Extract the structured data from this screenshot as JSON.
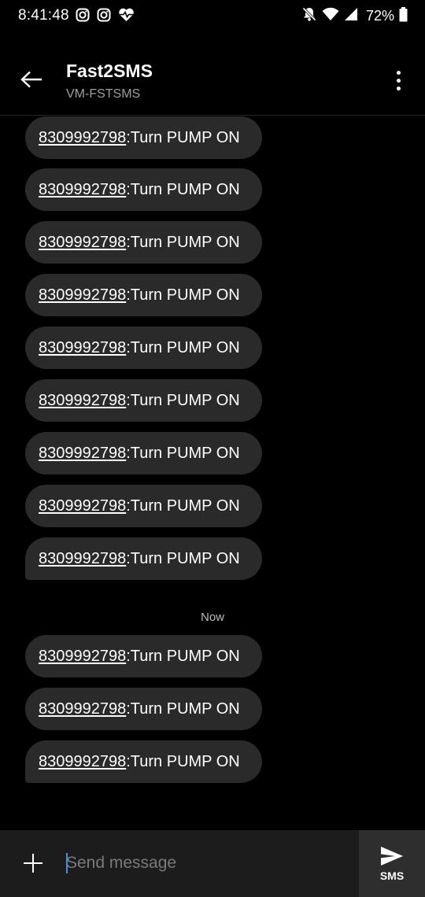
{
  "status_bar": {
    "time": "8:41:48",
    "battery_percent": "72%",
    "left_icons": [
      "instagram-icon",
      "instagram-icon",
      "heart-pulse-icon"
    ],
    "right_icons": [
      "mute-bell-icon",
      "wifi-icon",
      "signal-icon",
      "battery-icon"
    ]
  },
  "header": {
    "title": "Fast2SMS",
    "subtitle": "VM-FSTSMS"
  },
  "messages_group1": [
    {
      "number": "8309992798",
      "text": ":Turn PUMP ON"
    },
    {
      "number": "8309992798",
      "text": ":Turn PUMP ON"
    },
    {
      "number": "8309992798",
      "text": ":Turn PUMP ON"
    },
    {
      "number": "8309992798",
      "text": ":Turn PUMP ON"
    },
    {
      "number": "8309992798",
      "text": ":Turn PUMP ON"
    },
    {
      "number": "8309992798",
      "text": ":Turn PUMP ON"
    },
    {
      "number": "8309992798",
      "text": ":Turn PUMP ON"
    },
    {
      "number": "8309992798",
      "text": ":Turn PUMP ON"
    },
    {
      "number": "8309992798",
      "text": ":Turn PUMP ON"
    }
  ],
  "timestamp": "Now",
  "messages_group2": [
    {
      "number": "8309992798",
      "text": ":Turn PUMP ON"
    },
    {
      "number": "8309992798",
      "text": ":Turn PUMP ON"
    },
    {
      "number": "8309992798",
      "text": ":Turn PUMP ON"
    }
  ],
  "compose": {
    "placeholder": "Send message",
    "value": "",
    "send_label": "SMS"
  },
  "colors": {
    "background": "#000000",
    "bubble": "#2a2a2a",
    "compose_bar": "#1c1c1c",
    "cursor": "#4a90e2"
  }
}
